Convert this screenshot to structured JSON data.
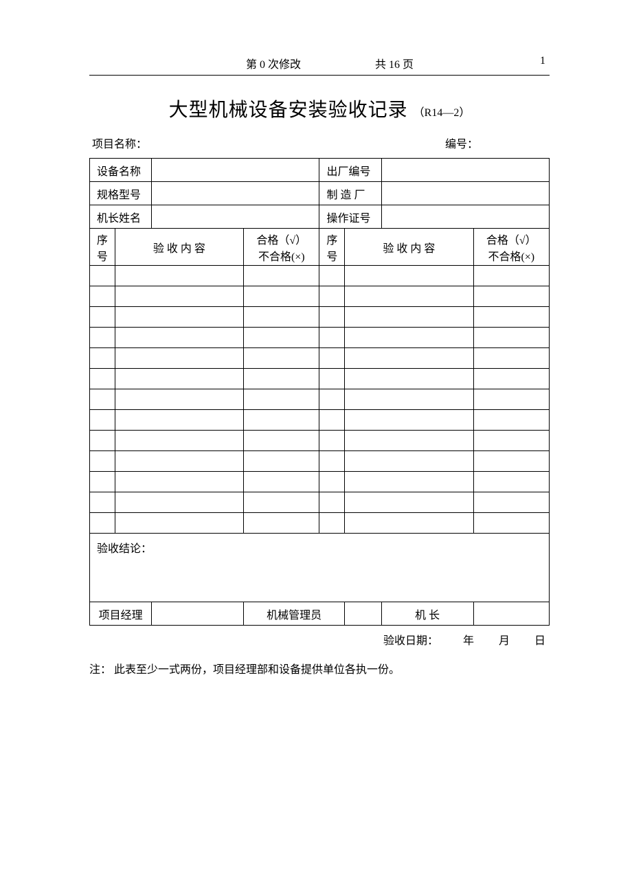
{
  "header": {
    "revision": "第 0 次修改",
    "total_pages": "共 16 页",
    "page_num": "1"
  },
  "title": {
    "main": "大型机械设备安装验收记录",
    "sub": "（R14—2）"
  },
  "meta": {
    "project_label": "项目名称：",
    "code_label": "编号："
  },
  "info": {
    "equip_name_label": "设备名称",
    "factory_no_label": "出厂编号",
    "spec_label": "规格型号",
    "manufacturer_label": "制 造 厂",
    "operator_name_label": "机长姓名",
    "license_no_label": "操作证号"
  },
  "columns": {
    "seq": "序号",
    "content": "验 收 内 容",
    "pass": "合格（√）",
    "fail": "不合格(×)"
  },
  "conclusion": {
    "label": "验收结论："
  },
  "sign": {
    "pm": "项目经理",
    "mech_admin": "机械管理员",
    "captain": "机 长"
  },
  "footer": {
    "date_label": "验收日期：",
    "year": "年",
    "month": "月",
    "day": "日"
  },
  "note": {
    "label": "注：",
    "text": "此表至少一式两份，项目经理部和设备提供单位各执一份。"
  }
}
